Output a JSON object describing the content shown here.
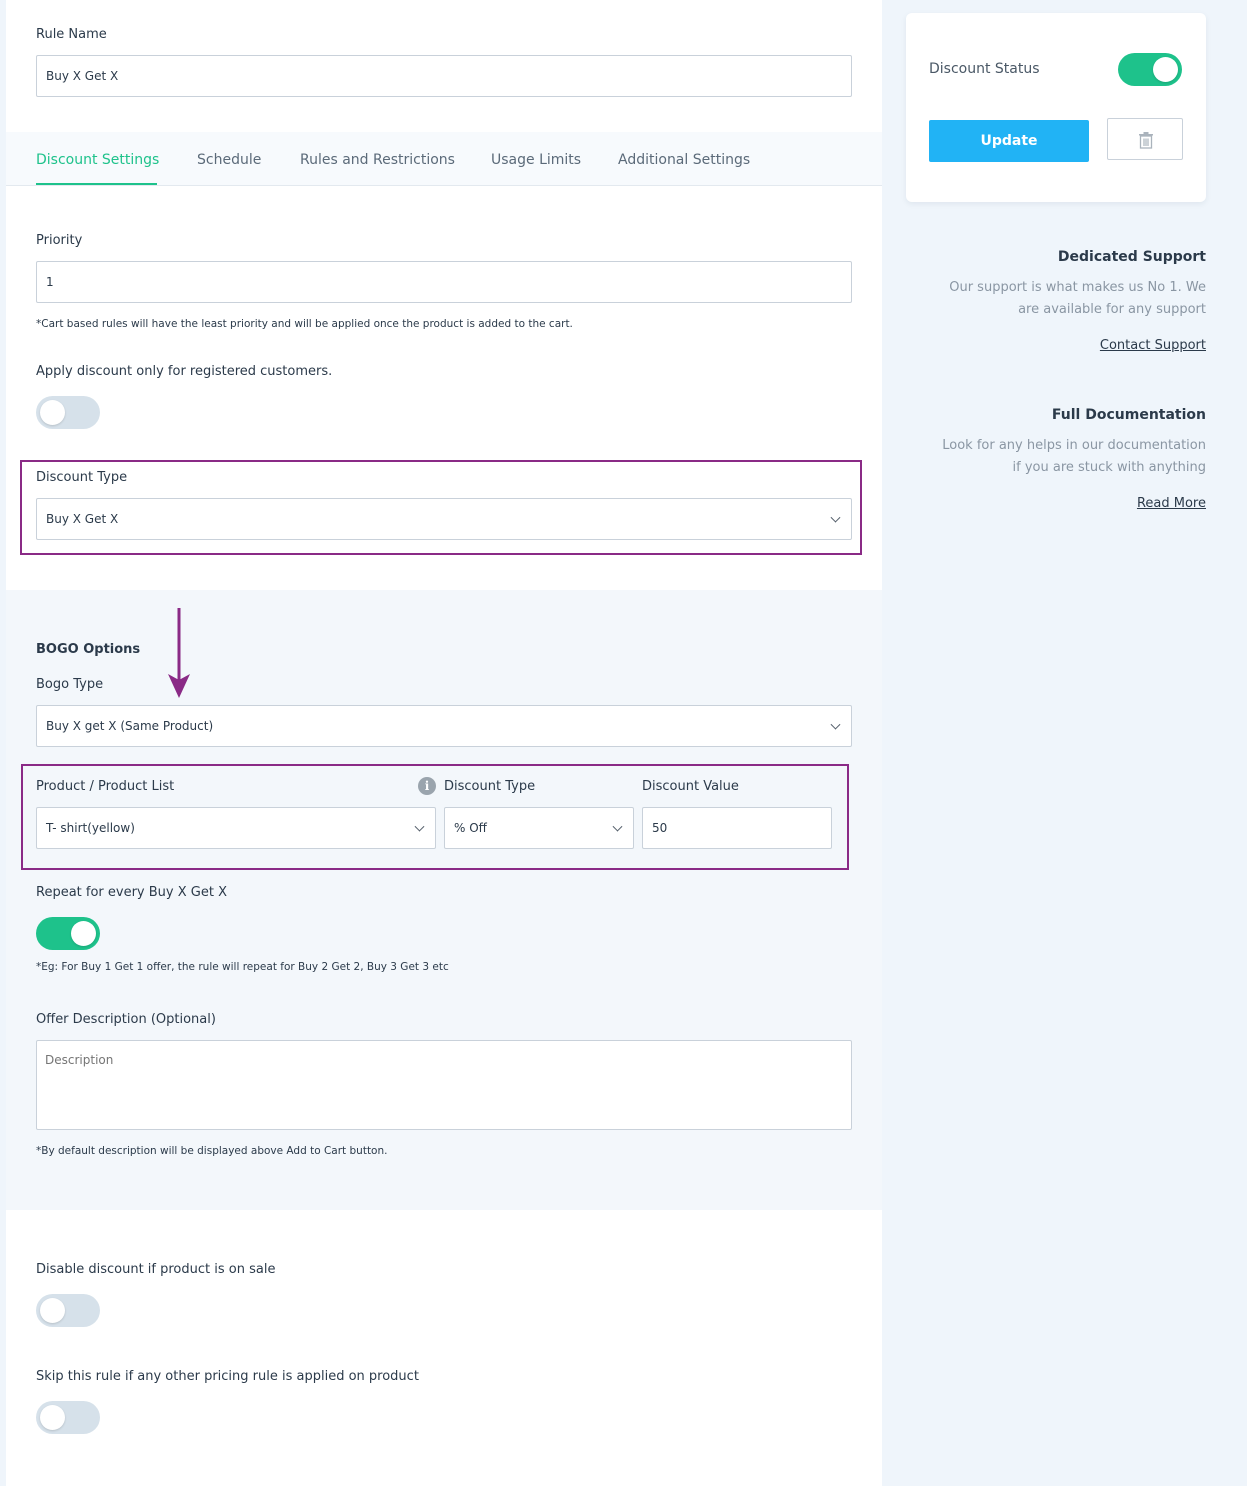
{
  "rule_name": {
    "label": "Rule Name",
    "value": "Buy X Get X"
  },
  "tabs": [
    {
      "label": "Discount Settings"
    },
    {
      "label": "Schedule"
    },
    {
      "label": "Rules and Restrictions"
    },
    {
      "label": "Usage Limits"
    },
    {
      "label": "Additional Settings"
    }
  ],
  "priority": {
    "label": "Priority",
    "value": "1",
    "note": "*Cart based rules will have the least priority and will be applied once the product is added to the cart."
  },
  "registered_only": {
    "label": "Apply discount only for registered customers.",
    "enabled": false
  },
  "discount_type": {
    "label": "Discount Type",
    "selected": "Buy X Get X"
  },
  "bogo": {
    "heading": "BOGO Options",
    "type_label": "Bogo Type",
    "type_selected": "Buy X get X (Same Product)",
    "product_label": "Product / Product List",
    "product_selected": "T- shirt(yellow)",
    "discount_type_label": "Discount Type",
    "discount_type_selected": "% Off",
    "discount_value_label": "Discount Value",
    "discount_value": "50",
    "info_icon": "info-icon"
  },
  "repeat": {
    "label": "Repeat for every Buy X Get X",
    "enabled": true,
    "note": "*Eg: For Buy 1 Get 1 offer, the rule will repeat for Buy 2 Get 2, Buy 3 Get 3 etc"
  },
  "offer_description": {
    "label": "Offer Description (Optional)",
    "placeholder": "Description",
    "note": "*By default description will be displayed above Add to Cart button."
  },
  "disable_on_sale": {
    "label": "Disable discount if product is on sale",
    "enabled": false
  },
  "skip_rule": {
    "label": "Skip this rule if any other pricing rule is applied on product",
    "enabled": false
  },
  "sidebar": {
    "status_label": "Discount Status",
    "status_enabled": true,
    "update_label": "Update",
    "delete_icon": "trash-icon",
    "support_title": "Dedicated Support",
    "support_line1": "Our support is what makes us No 1. We",
    "support_line2": "are available for any support",
    "support_link": "Contact Support",
    "docs_title": "Full Documentation",
    "docs_line1": "Look for any helps in our documentation",
    "docs_line2": "if you are stuck with anything",
    "docs_link": "Read More"
  },
  "colors": {
    "accent_green": "#1ec28b",
    "button_blue": "#21b3f5",
    "highlight_purple": "#8a2a86"
  }
}
